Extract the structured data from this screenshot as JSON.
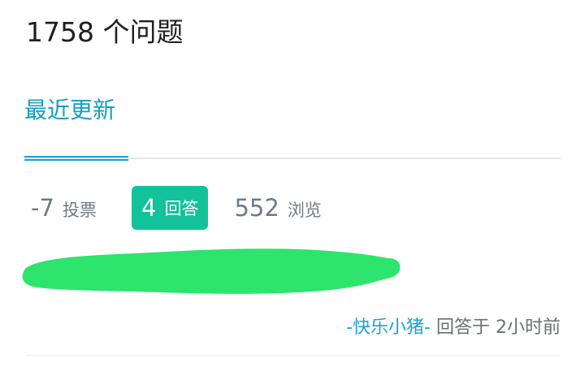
{
  "header": {
    "question_count": "1758 个问题"
  },
  "tabs": [
    {
      "label": "最近更新",
      "active": true
    }
  ],
  "question": {
    "votes": {
      "value": "-7",
      "label": "投票"
    },
    "answers": {
      "value": "4",
      "label": "回答"
    },
    "views": {
      "value": "552",
      "label": "浏览"
    },
    "author": "-快乐小猪-",
    "action": "回答于",
    "time": "2小时前"
  },
  "colors": {
    "accent": "#1ba3d6",
    "answers_badge": "#12c29a",
    "redaction": "#2de46c"
  }
}
